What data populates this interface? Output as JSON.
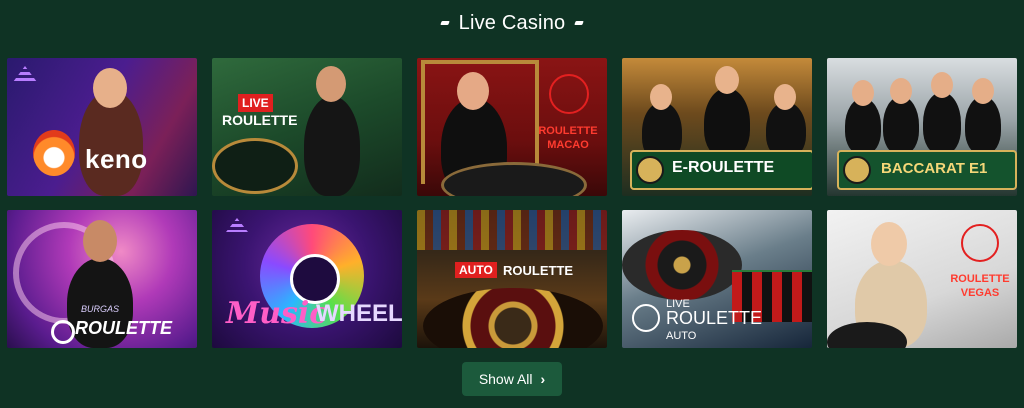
{
  "section": {
    "title": "Live Casino"
  },
  "tiles": [
    {
      "name": "Keno",
      "label": "keno"
    },
    {
      "name": "Live Roulette",
      "badge": "LIVE",
      "label": "ROULETTE"
    },
    {
      "name": "Roulette Macao",
      "label": "ROULETTE MACAO"
    },
    {
      "name": "E-Roulette",
      "label": "E-ROULETTE"
    },
    {
      "name": "Baccarat E1",
      "label": "BACCARAT E1"
    },
    {
      "name": "Burgas Roulette",
      "small": "BURGAS",
      "label": "ROULETTE"
    },
    {
      "name": "Music Wheel",
      "label_a": "Music",
      "label_b": "WHEEL"
    },
    {
      "name": "Auto Roulette",
      "badge": "AUTO",
      "label": "ROULETTE"
    },
    {
      "name": "Live Roulette Auto",
      "l1": "LIVE",
      "l2": "ROULETTE",
      "l3": "AUTO"
    },
    {
      "name": "Roulette Vegas",
      "label": "ROULETTE VEGAS"
    }
  ],
  "show_all": {
    "label": "Show All",
    "icon": "chevron-right-icon"
  }
}
